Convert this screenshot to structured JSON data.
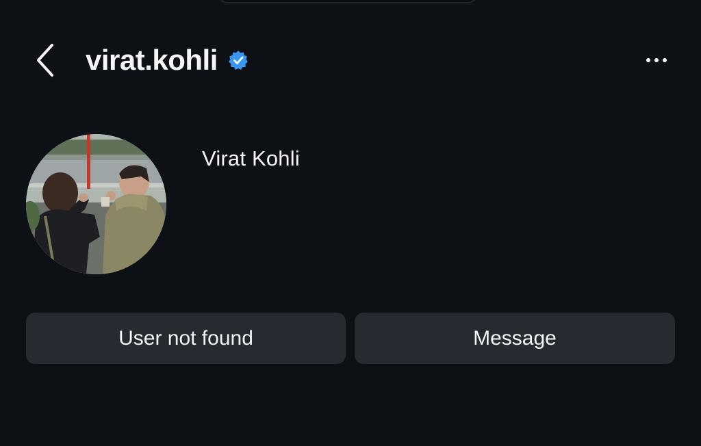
{
  "header": {
    "username": "virat.kohli",
    "back_icon": "chevron-left-icon",
    "verified_icon": "verified-badge-icon",
    "more_icon": "more-horizontal-icon"
  },
  "profile": {
    "display_name": "Virat Kohli",
    "avatar": "profile-photo"
  },
  "actions": {
    "primary_label": "User not found",
    "message_label": "Message"
  },
  "colors": {
    "background": "#0d1015",
    "button": "#262a31",
    "text": "#f4f5f6",
    "verified_blue": "#3897f0"
  }
}
